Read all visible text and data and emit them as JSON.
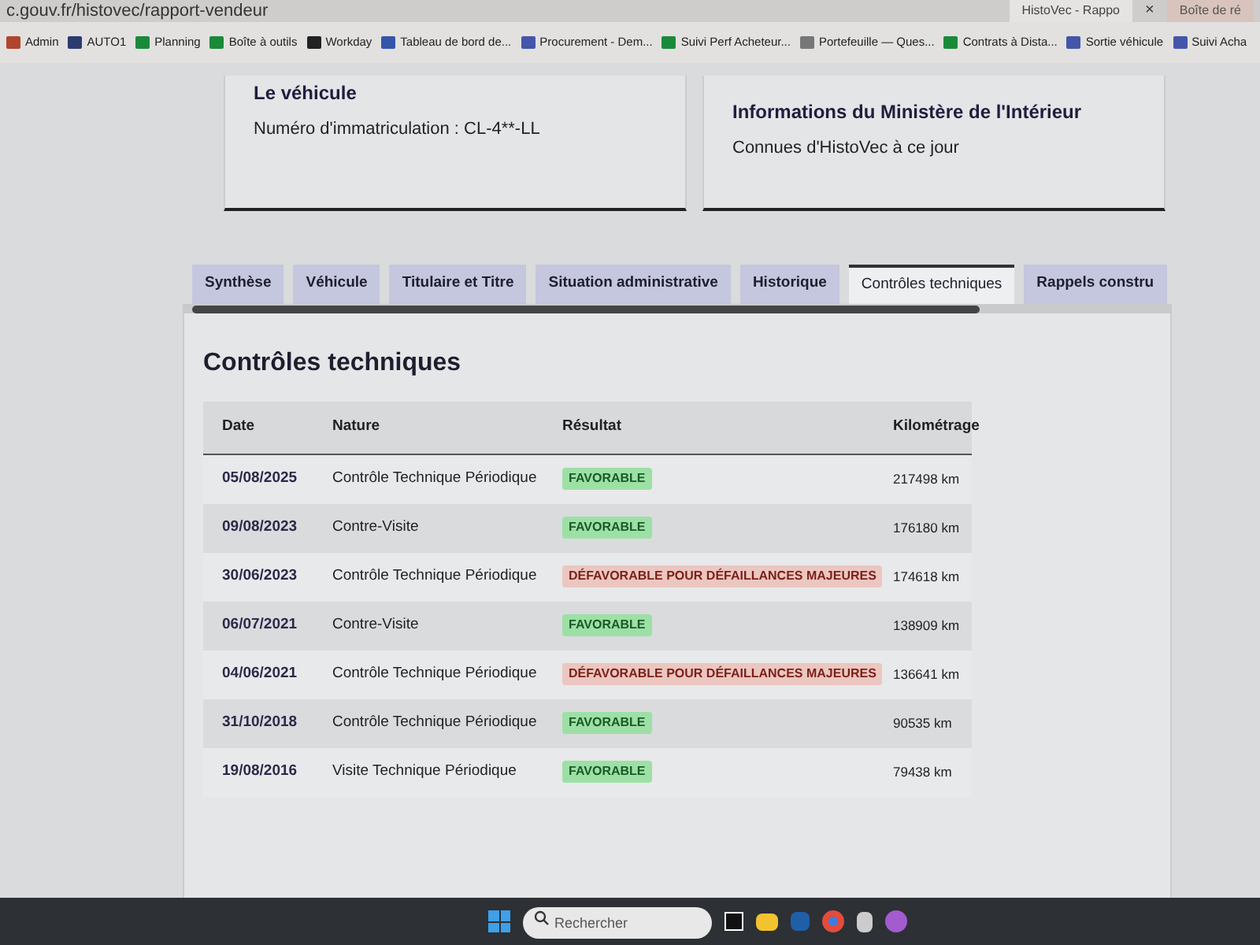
{
  "browser": {
    "url": "c.gouv.fr/histovec/rapport-vendeur",
    "tabs": [
      {
        "label": "HistoVec - Rappo",
        "selected": true,
        "close": "×"
      },
      {
        "label": "Boîte de ré",
        "selected": false
      }
    ]
  },
  "bookmarks": [
    "Admin",
    "AUTO1",
    "Planning",
    "Boîte à outils",
    "Workday",
    "Tableau de bord de...",
    "Procurement - Dem...",
    "Suivi Perf Acheteur...",
    "Portefeuille — Ques...",
    "Contrats à Dista...",
    "Sortie véhicule",
    "Suivi Acha"
  ],
  "cards": [
    {
      "title": "Le véhicule",
      "text": "Numéro d'immatriculation : CL-4**-LL"
    },
    {
      "title": "Informations du Ministère de l'Intérieur",
      "text": "Connues d'HistoVec à ce jour"
    }
  ],
  "tabs": [
    {
      "label": "Synthèse",
      "selected": false
    },
    {
      "label": "Véhicule",
      "selected": false
    },
    {
      "label": "Titulaire et Titre",
      "selected": false
    },
    {
      "label": "Situation administrative",
      "selected": false
    },
    {
      "label": "Historique",
      "selected": false
    },
    {
      "label": "Contrôles techniques",
      "selected": true
    },
    {
      "label": "Rappels constru",
      "selected": false
    }
  ],
  "section": {
    "title": "Contrôles techniques"
  },
  "table": {
    "columns": [
      "Date",
      "Nature",
      "Résultat",
      "Kilométrage"
    ],
    "rows": [
      {
        "date": "05/08/2025",
        "nature": "Contrôle Technique Périodique",
        "result": "FAVORABLE",
        "kind": "favorable",
        "km": "217498 km"
      },
      {
        "date": "09/08/2023",
        "nature": "Contre-Visite",
        "result": "FAVORABLE",
        "kind": "favorable",
        "km": "176180 km"
      },
      {
        "date": "30/06/2023",
        "nature": "Contrôle Technique Périodique",
        "result": "DÉFAVORABLE POUR DÉFAILLANCES MAJEURES",
        "kind": "defavorable",
        "km": "174618 km"
      },
      {
        "date": "06/07/2021",
        "nature": "Contre-Visite",
        "result": "FAVORABLE",
        "kind": "favorable",
        "km": "138909 km"
      },
      {
        "date": "04/06/2021",
        "nature": "Contrôle Technique Périodique",
        "result": "DÉFAVORABLE POUR DÉFAILLANCES MAJEURES",
        "kind": "defavorable",
        "km": "136641 km"
      },
      {
        "date": "31/10/2018",
        "nature": "Contrôle Technique Périodique",
        "result": "FAVORABLE",
        "kind": "favorable",
        "km": "90535 km"
      },
      {
        "date": "19/08/2016",
        "nature": "Visite Technique Périodique",
        "result": "FAVORABLE",
        "kind": "favorable",
        "km": "79438 km"
      }
    ]
  },
  "taskbar": {
    "search": {
      "placeholder": "Rechercher"
    }
  }
}
